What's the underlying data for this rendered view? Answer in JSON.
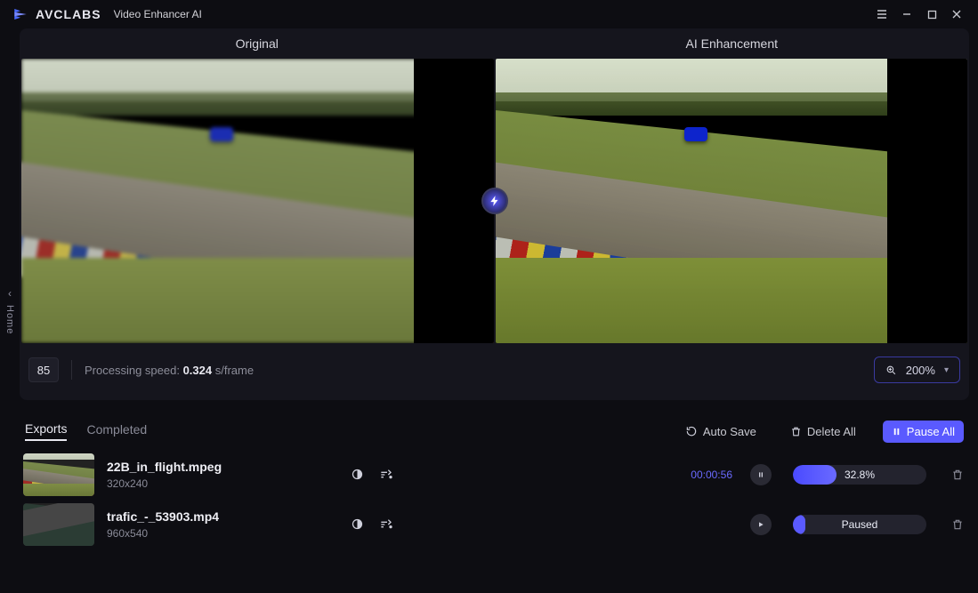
{
  "app": {
    "brand": "AVCLABS",
    "product": "Video Enhancer AI"
  },
  "siderail": {
    "label": "Home"
  },
  "preview": {
    "left_title": "Original",
    "right_title": "AI Enhancement",
    "frame": "85",
    "speed_prefix": "Processing speed: ",
    "speed_value": "0.324",
    "speed_suffix": " s/frame",
    "zoom": "200%"
  },
  "exports_bar": {
    "tab_exports": "Exports",
    "tab_completed": "Completed",
    "autosave": "Auto Save",
    "delete_all": "Delete All",
    "pause_all": "Pause All"
  },
  "exports": [
    {
      "filename": "22B_in_flight.mpeg",
      "resolution": "320x240",
      "elapsed": "00:00:56",
      "state": "running",
      "progress_pct": 32.8,
      "progress_label": "32.8%"
    },
    {
      "filename": "trafic_-_53903.mp4",
      "resolution": "960x540",
      "elapsed": "",
      "state": "paused",
      "progress_pct": 0,
      "progress_label": "Paused"
    }
  ]
}
